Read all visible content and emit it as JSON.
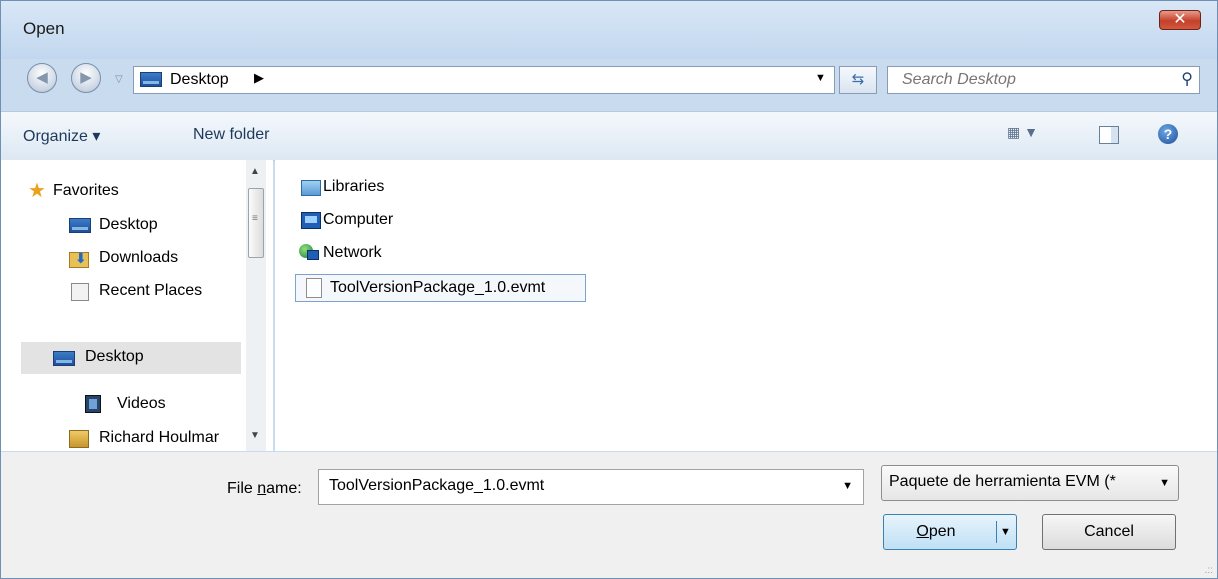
{
  "window": {
    "title": "Open"
  },
  "titlebar": {
    "close_icon": "close-icon"
  },
  "address": {
    "location": "Desktop",
    "refresh_icon": "refresh-icon",
    "search_placeholder": "Search Desktop"
  },
  "toolbar": {
    "organize_label": "Organize ▾",
    "new_folder_label": "New folder",
    "views_icon": "views-icon",
    "preview_pane_icon": "preview-pane-icon",
    "help_icon": "help-icon"
  },
  "navpane": {
    "favorites": "Favorites",
    "items": [
      {
        "label": "Desktop",
        "icon": "desktop-icon"
      },
      {
        "label": "Downloads",
        "icon": "downloads-icon"
      },
      {
        "label": "Recent Places",
        "icon": "recent-places-icon"
      }
    ],
    "desktop": "Desktop",
    "subitems": [
      {
        "label": "Videos",
        "icon": "videos-icon"
      },
      {
        "label": "Richard Houlmar",
        "icon": "user-folder-icon"
      }
    ]
  },
  "content": {
    "items": [
      {
        "label": "Libraries",
        "icon": "libraries-icon"
      },
      {
        "label": "Computer",
        "icon": "computer-icon"
      },
      {
        "label": "Network",
        "icon": "network-icon"
      },
      {
        "label": "ToolVersionPackage_1.0.evmt",
        "icon": "document-icon"
      }
    ]
  },
  "bottom": {
    "file_name_label_pre": "File ",
    "file_name_label_u": "n",
    "file_name_label_post": "ame:",
    "file_name_value": "ToolVersionPackage_1.0.evmt",
    "file_type_value": "Paquete de herramienta EVM (*",
    "open_label_u": "O",
    "open_label_post": "pen",
    "cancel_label": "Cancel"
  }
}
